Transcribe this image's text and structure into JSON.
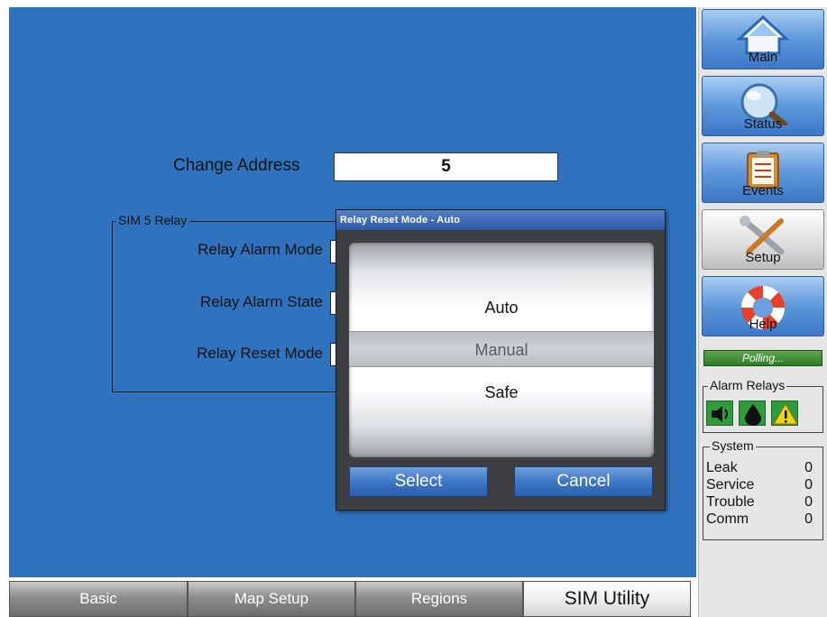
{
  "main": {
    "change_address_label": "Change Address",
    "change_address_value": "5",
    "group_title": "SIM 5 Relay",
    "relay_alarm_mode_label": "Relay Alarm Mode",
    "relay_alarm_state_label": "Relay Alarm State",
    "relay_reset_mode_label": "Relay Reset Mode"
  },
  "dialog": {
    "title": "Relay Reset Mode - Auto",
    "options": [
      "Auto",
      "Manual",
      "Safe"
    ],
    "selected": "Manual",
    "select_label": "Select",
    "cancel_label": "Cancel"
  },
  "tabs": [
    {
      "label": "Basic",
      "active": false
    },
    {
      "label": "Map Setup",
      "active": false
    },
    {
      "label": "Regions",
      "active": false
    },
    {
      "label": "SIM Utility",
      "active": true
    }
  ],
  "sidebar": {
    "nav": [
      {
        "label": "Main",
        "icon": "home-icon"
      },
      {
        "label": "Status",
        "icon": "magnifier-icon"
      },
      {
        "label": "Events",
        "icon": "clipboard-icon"
      },
      {
        "label": "Setup",
        "icon": "tools-icon",
        "active": true
      },
      {
        "label": "Help",
        "icon": "lifebuoy-icon"
      }
    ],
    "polling_text": "Polling...",
    "alarm_relays_title": "Alarm Relays",
    "alarm_icons": [
      "speaker-icon",
      "drop-icon",
      "warning-icon"
    ],
    "system_title": "System",
    "system": [
      {
        "label": "Leak",
        "value": "0"
      },
      {
        "label": "Service",
        "value": "0"
      },
      {
        "label": "Trouble",
        "value": "0"
      },
      {
        "label": "Comm",
        "value": "0"
      }
    ]
  },
  "colors": {
    "panel_blue": "#2f73bf",
    "accent_green": "#2e9c3d",
    "warning_yellow": "#f1d21b"
  }
}
